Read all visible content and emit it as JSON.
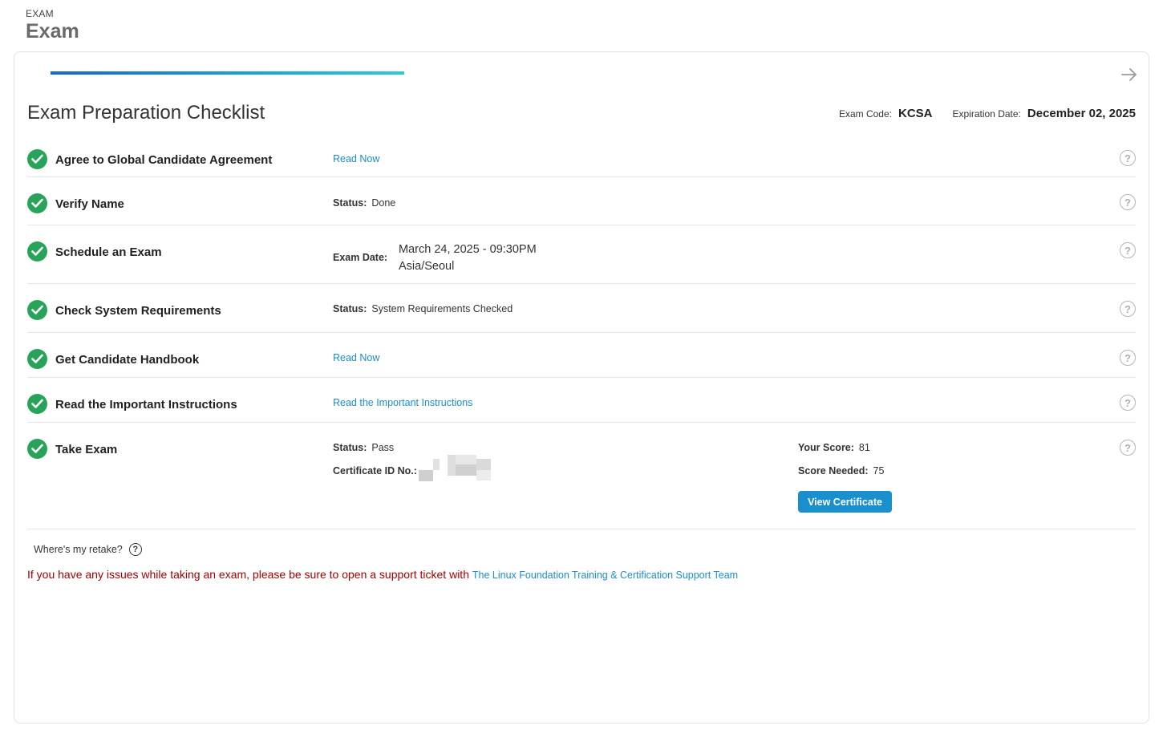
{
  "header": {
    "eyebrow": "EXAM",
    "title": "Exam"
  },
  "progress": {
    "percent": 32
  },
  "checklist": {
    "title": "Exam Preparation Checklist",
    "exam_code_label": "Exam Code:",
    "exam_code": "KCSA",
    "expiration_label": "Expiration Date:",
    "expiration": "December 02, 2025"
  },
  "rows": {
    "agreement": {
      "title": "Agree to Global Candidate Agreement",
      "link": "Read Now"
    },
    "verify": {
      "title": "Verify Name",
      "status_label": "Status:",
      "status": "Done"
    },
    "schedule": {
      "title": "Schedule an Exam",
      "date_label": "Exam Date:",
      "date": "March 24, 2025 - 09:30PM",
      "timezone": "Asia/Seoul"
    },
    "system": {
      "title": "Check System Requirements",
      "status_label": "Status:",
      "status": "System Requirements Checked"
    },
    "handbook": {
      "title": "Get Candidate Handbook",
      "link": "Read Now"
    },
    "instructions": {
      "title": "Read the Important Instructions",
      "link": "Read the Important Instructions"
    },
    "take": {
      "title": "Take Exam",
      "status_label": "Status:",
      "status": "Pass",
      "cert_label": "Certificate ID No.:",
      "score_label": "Your Score:",
      "score": "81",
      "needed_label": "Score Needed:",
      "needed": "75",
      "button": "View Certificate"
    }
  },
  "help_glyph": "?",
  "footer": {
    "retake": "Where's my retake?",
    "notice": "If you have any issues while taking an exam, please be sure to open a support ticket with",
    "support_link": "The Linux Foundation Training & Certification Support Team"
  },
  "colors": {
    "check": "#28a45a",
    "link": "#1a8fc9",
    "notice": "#a40000",
    "button": "#1990cd"
  },
  "icons": {
    "check": "check-circle-icon",
    "help": "question-circle-icon",
    "next": "arrow-right-icon"
  }
}
